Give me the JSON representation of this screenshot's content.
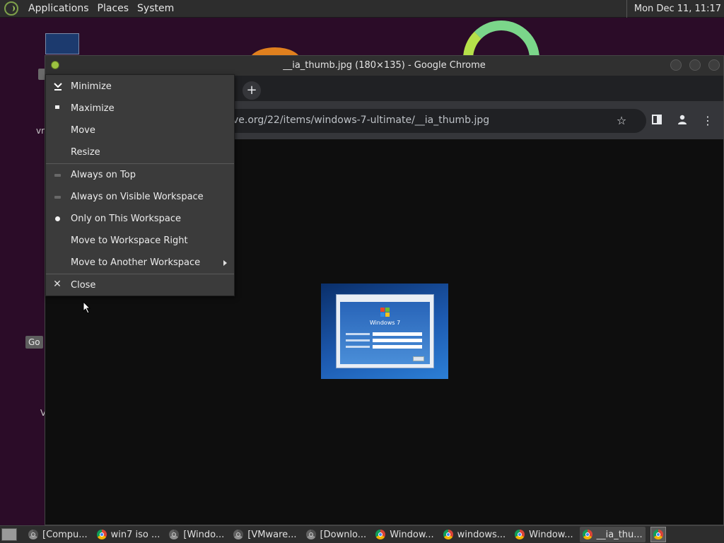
{
  "top_panel": {
    "menus": [
      "Applications",
      "Places",
      "System"
    ],
    "clock": "Mon Dec 11, 11:17"
  },
  "desktop": {
    "labels": [
      "vr",
      "Go",
      "V"
    ]
  },
  "chrome": {
    "window_title": "__ia_thumb.jpg (180×135) - Google Chrome",
    "new_tab_symbol": "+",
    "url_visible": "ve.org/22/items/windows-7-ultimate/__ia_thumb.jpg",
    "image_caption": "Windows 7"
  },
  "window_menu": {
    "items": [
      {
        "label": "Minimize",
        "icon": "minimize-chevron-icon"
      },
      {
        "label": "Maximize",
        "icon": "maximize-square-icon"
      },
      {
        "label": "Move"
      },
      {
        "label": "Resize"
      },
      {
        "label": "Always on Top",
        "icon": "unchecked-indicator-icon"
      },
      {
        "label": "Always on Visible Workspace",
        "icon": "unchecked-indicator-icon"
      },
      {
        "label": "Only on This Workspace",
        "icon": "radio-selected-icon"
      },
      {
        "label": "Move to Workspace Right"
      },
      {
        "label": "Move to Another Workspace",
        "icon": "submenu-arrow-icon"
      },
      {
        "label": "Close",
        "icon": "close-x-icon"
      }
    ]
  },
  "taskbar": {
    "tasks": [
      {
        "label": "[Compu...",
        "active": false
      },
      {
        "label": "win7 iso ...",
        "active": false
      },
      {
        "label": "[Windo...",
        "active": false
      },
      {
        "label": "[VMware...",
        "active": false
      },
      {
        "label": "[Downlo...",
        "active": false
      },
      {
        "label": "Window...",
        "active": false
      },
      {
        "label": "windows...",
        "active": false
      },
      {
        "label": "Window...",
        "active": false
      },
      {
        "label": "__ia_thu...",
        "active": true
      }
    ]
  }
}
